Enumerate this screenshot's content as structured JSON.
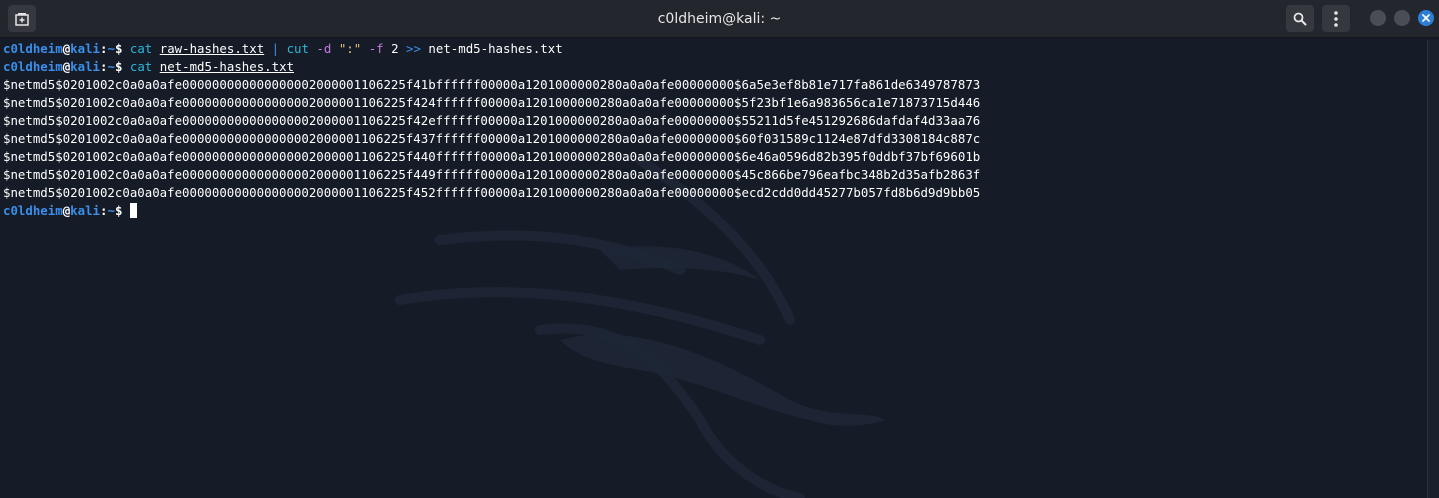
{
  "window": {
    "title": "c0ldheim@kali: ~"
  },
  "icons": {
    "new_tab": "new-tab-icon",
    "search": "search-icon",
    "menu": "kebab-menu-icon",
    "minimize": "minimize-icon",
    "maximize": "maximize-icon",
    "close": "close-icon"
  },
  "colors": {
    "accent": "#2d7fd6",
    "prompt_user": "#3b8eea",
    "command": "#2ab7d9",
    "option": "#c678dd",
    "string": "#e5c07b",
    "background": "#151c27"
  },
  "prompt": {
    "user": "c0ldheim",
    "at": "@",
    "host": "kali",
    "colon": ":",
    "path": "~",
    "dollar": "$"
  },
  "commands": [
    {
      "cmd": "cat",
      "file": "raw-hashes.txt",
      "pipe": "|",
      "cmd2": "cut",
      "opt1": "-d",
      "delim": "\":\"",
      "opt2": "-f",
      "field": "2",
      "redir": ">>",
      "outfile": "net-md5-hashes.txt"
    },
    {
      "cmd": "cat",
      "file": "net-md5-hashes.txt"
    }
  ],
  "output": [
    "$netmd5$0201002c0a0a0afe000000000000000002000001106225f41bffffff00000a1201000000280a0a0afe00000000$6a5e3ef8b81e717fa861de6349787873",
    "$netmd5$0201002c0a0a0afe000000000000000002000001106225f424ffffff00000a1201000000280a0a0afe00000000$5f23bf1e6a983656ca1e71873715d446",
    "$netmd5$0201002c0a0a0afe000000000000000002000001106225f42effffff00000a1201000000280a0a0afe00000000$55211d5fe451292686dafdaf4d33aa76",
    "$netmd5$0201002c0a0a0afe000000000000000002000001106225f437ffffff00000a1201000000280a0a0afe00000000$60f031589c1124e87dfd3308184c887c",
    "$netmd5$0201002c0a0a0afe000000000000000002000001106225f440ffffff00000a1201000000280a0a0afe00000000$6e46a0596d82b395f0ddbf37bf69601b",
    "$netmd5$0201002c0a0a0afe000000000000000002000001106225f449ffffff00000a1201000000280a0a0afe00000000$45c866be796eafbc348b2d35afb2863f",
    "$netmd5$0201002c0a0a0afe000000000000000002000001106225f452ffffff00000a1201000000280a0a0afe00000000$ecd2cdd0dd45277b057fd8b6d9d9bb05"
  ]
}
